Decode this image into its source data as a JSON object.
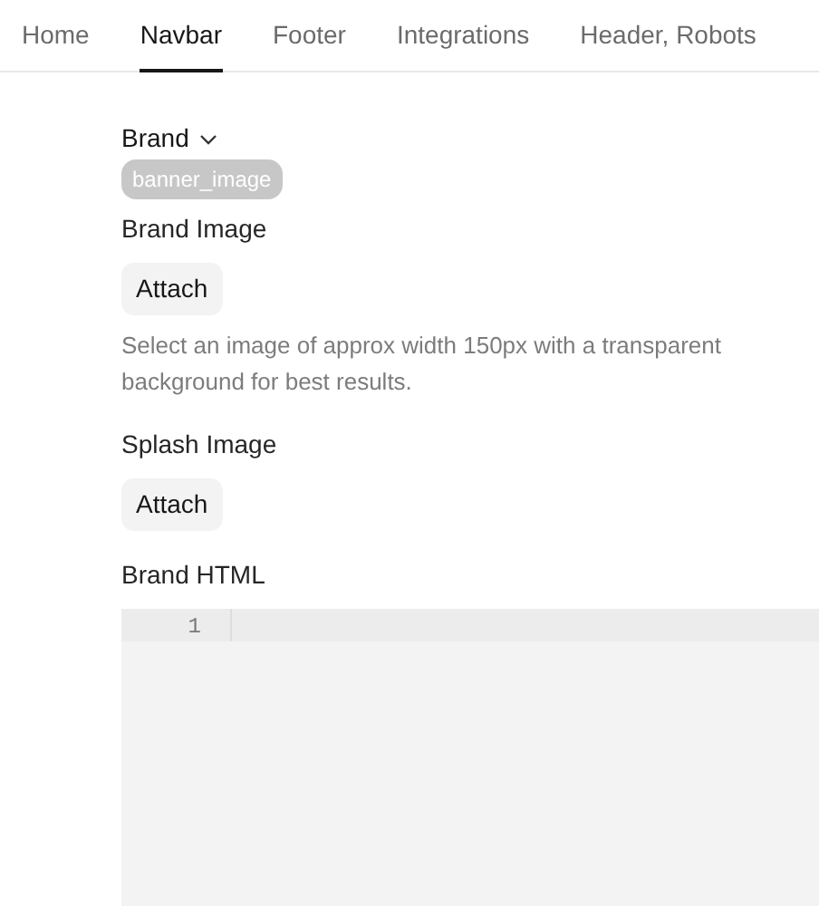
{
  "tabs": [
    {
      "label": "Home",
      "selected": false
    },
    {
      "label": "Navbar",
      "selected": true
    },
    {
      "label": "Footer",
      "selected": false
    },
    {
      "label": "Integrations",
      "selected": false
    },
    {
      "label": "Header, Robots",
      "selected": false
    }
  ],
  "section": {
    "title": "Brand",
    "expanded": true,
    "tag": "banner_image"
  },
  "fields": [
    {
      "kind": "attach",
      "label": "Brand Image",
      "button": "Attach",
      "help": "Select an image of approx width 150px with a transparent background for best results."
    },
    {
      "kind": "attach",
      "label": "Splash Image",
      "button": "Attach"
    },
    {
      "kind": "code",
      "label": "Brand HTML",
      "line_numbers": [
        "1"
      ]
    }
  ]
}
